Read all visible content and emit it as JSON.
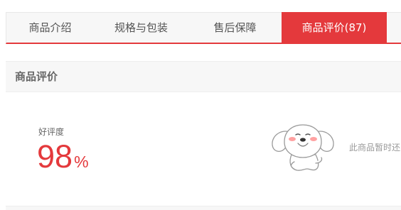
{
  "tabs": [
    {
      "label": "商品介绍",
      "active": false
    },
    {
      "label": "规格与包装",
      "active": false
    },
    {
      "label": "售后保障",
      "active": false
    },
    {
      "label": "商品评价(87)",
      "active": true
    }
  ],
  "section": {
    "title": "商品评价"
  },
  "rating": {
    "label": "好评度",
    "value": "98",
    "unit": "%"
  },
  "empty": {
    "text": "此商品暂时还"
  },
  "mascot": {
    "icon": "jd-dog-mascot-icon"
  },
  "colors": {
    "accent": "#e4393c",
    "tab_bg": "#f7f7f7",
    "muted_text": "#999999"
  }
}
